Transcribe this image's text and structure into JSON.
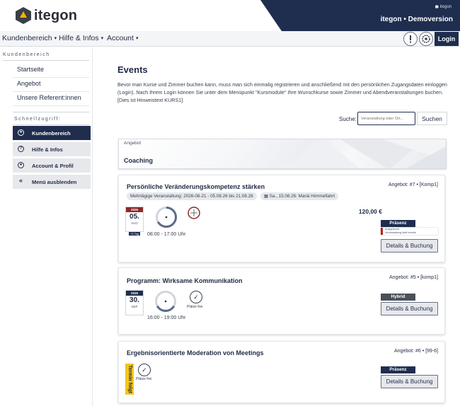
{
  "header": {
    "logo_text": "itegon",
    "brand_mini": "itegon",
    "brand_name": "itegon • Demoversion"
  },
  "nav": {
    "items": [
      "Kundenbereich",
      "Hilfe & Infos",
      "Account"
    ],
    "login_label": "Login"
  },
  "sidebar": {
    "heading": "Kundenbereich",
    "links": [
      "Startseite",
      "Angebot",
      "Unsere Referent:innen"
    ],
    "quick_heading": "Schnellzugriff:",
    "buttons": [
      "Kundenbereich",
      "Hilfe & Infos",
      "Account & Profil",
      "Menü ausblenden"
    ]
  },
  "main": {
    "title": "Events",
    "intro": "Bevor man Kurse und Zimmer buchen kann, muss man sich einmalig registrieren und anschließend mit den persönlichen Zugangsdaten einloggen (Login). Nach Ihrem Login können Sie unter dem Menüpunkt \"Kursmodule\" Ihre Wunschkurse sowie Zimmer und Abendveranstaltungen buchen. [Dies ist Hinweistext KURS1]",
    "search_label": "Suche:",
    "search_placeholder": "Veranstaltung oder Ort...",
    "search_button": "Suchen",
    "category_small": "Angebot",
    "category_title": "Coaching"
  },
  "cards": [
    {
      "title": "Persönliche Veränderungskompetenz stärken",
      "ref": "Angebot: #7 • [Komp1]",
      "tag1": "Mehrtägige Veranstaltung: 2026-08-21 - 05.08.26 bis 21.08.26",
      "tag2": "Sa., 15.08.26: Mariä Himmelfahrt",
      "cal_year": "2026",
      "cal_day": "05.",
      "cal_month": "AUG",
      "cal_badge": "+3 Tag",
      "time": "08:00 - 17:00 Uhr",
      "price": "120,00 €",
      "mode": "Präsenz",
      "booked_line1": "Ausgebucht",
      "booked_line2": "Veranstaltung läuft bereits",
      "button": "Details & Buchung"
    },
    {
      "title": "Programm: Wirksame Kommunikation",
      "ref": "Angebot: #5 • [komp1]",
      "cal_year": "2026",
      "cal_day": "30.",
      "cal_month": "SEP",
      "places": "Plätze frei",
      "time": "16:00 - 19:00 Uhr",
      "mode": "Hybrid",
      "button": "Details & Buchung"
    },
    {
      "title": "Ergebnisorientierte Moderation von Meetings",
      "ref": "Angebot: #6 • [99-6]",
      "request": "Termin folgt",
      "places": "Plätze frei",
      "mode": "Präsenz",
      "button": "Details & Buchung"
    }
  ],
  "colors": {
    "navy": "#1f2d4f",
    "calendar_red": "#8b2a2a",
    "calendar_blue": "#1f2d4f",
    "booked_red": "#b42318",
    "request_yellow": "#f5c518"
  }
}
